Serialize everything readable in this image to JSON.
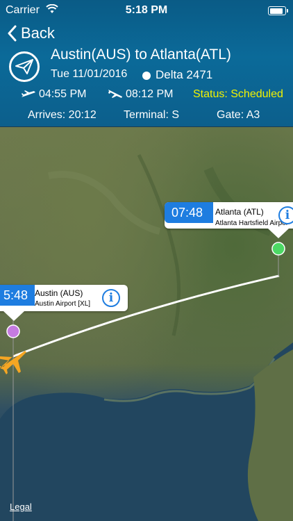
{
  "status_bar": {
    "carrier": "Carrier",
    "time": "5:18 PM",
    "battery_level": 1.0
  },
  "nav": {
    "back_label": "Back"
  },
  "flight": {
    "route": "Austin(AUS) to Atlanta(ATL)",
    "date": "Tue 11/01/2016",
    "airline_flight": "Delta 2471",
    "departure_time": "04:55 PM",
    "arrival_time": "08:12 PM",
    "status": "Status: Scheduled",
    "arrives": "Arrives: 20:12",
    "terminal": "Terminal: S",
    "gate": "Gate: A3"
  },
  "map": {
    "origin": {
      "time": "5:48",
      "name": "Austin (AUS)",
      "airport": "Austin Airport [XL]"
    },
    "destination": {
      "time": "07:48",
      "name": "Atlanta (ATL)",
      "airport": "Atlanta Hartsfield Airport"
    },
    "legal_label": "Legal"
  },
  "colors": {
    "header": "#0b6a99",
    "status": "#f2f200",
    "accent": "#1e7de0",
    "plane": "#f5a623",
    "origin_pin": "#c57be0",
    "destination_pin": "#4cd964"
  }
}
